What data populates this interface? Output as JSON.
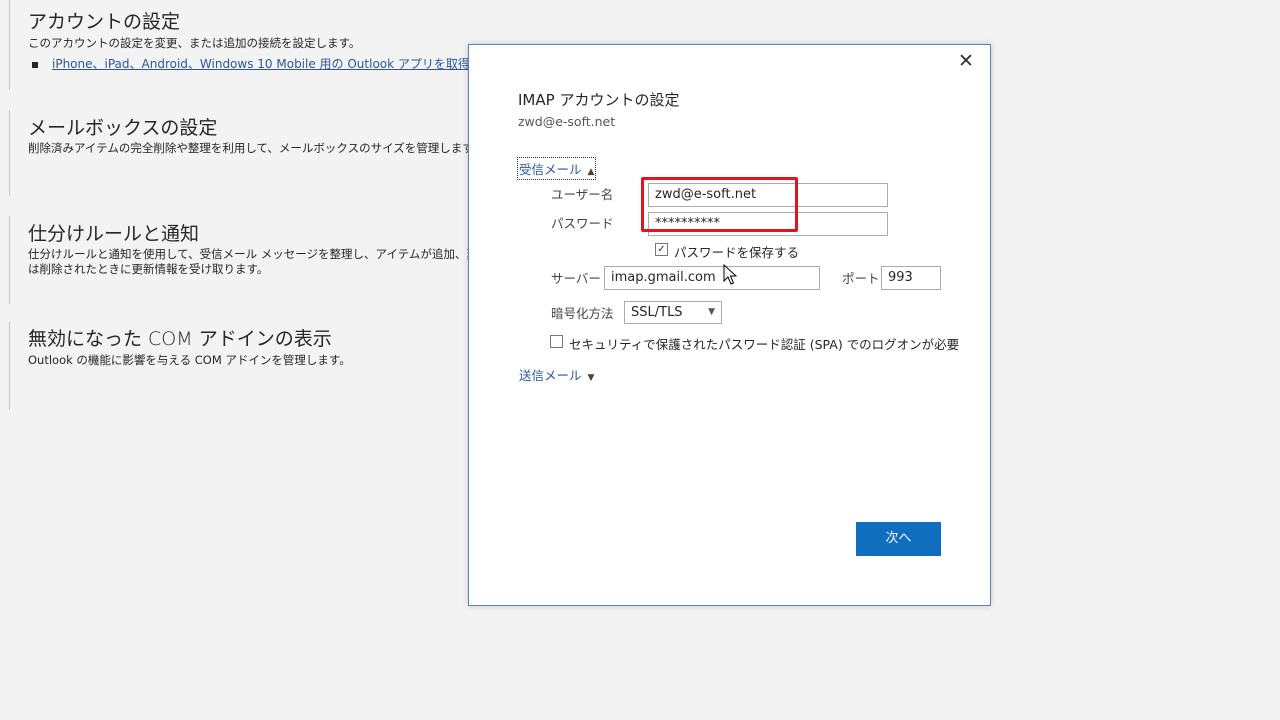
{
  "background": {
    "account": {
      "title": "アカウントの設定",
      "desc": "このアカウントの設定を変更、または追加の接続を設定します。",
      "link": "iPhone、iPad、Android、Windows 10 Mobile 用の Outlook アプリを取得します"
    },
    "mailbox": {
      "title": "メールボックスの設定",
      "desc": "削除済みアイテムの完全削除や整理を利用して、メールボックスのサイズを管理します。"
    },
    "rules": {
      "title": "仕分けルールと通知",
      "desc1": "仕分けルールと通知を使用して、受信メール メッセージを整理し、アイテムが追加、変更、または",
      "desc2": "は削除されたときに更新情報を受け取ります。"
    },
    "com": {
      "title": "無効になった COM アドインの表示",
      "desc": "Outlook の機能に影響を与える COM アドインを管理します。"
    }
  },
  "dialog": {
    "close_icon": "close-icon",
    "title": "IMAP アカウントの設定",
    "email": "zwd@e-soft.net",
    "incoming": {
      "toggle_label": "受信メール",
      "username_label": "ユーザー名",
      "username_value": "zwd@e-soft.net",
      "password_label": "パスワード",
      "password_value": "**********",
      "save_password_label": "パスワードを保存する",
      "save_password_checked": true,
      "server_label": "サーバー",
      "server_value": "imap.gmail.com",
      "port_label": "ポート",
      "port_value": "993",
      "encryption_label": "暗号化方法",
      "encryption_value": "SSL/TLS",
      "spa_label": "セキュリティで保護されたパスワード認証 (SPA) でのログオンが必要",
      "spa_checked": false
    },
    "outgoing": {
      "toggle_label": "送信メール"
    },
    "next_label": "次へ"
  },
  "colors": {
    "accent": "#106ebe",
    "link": "#2b5797",
    "highlight": "#e0141e"
  }
}
